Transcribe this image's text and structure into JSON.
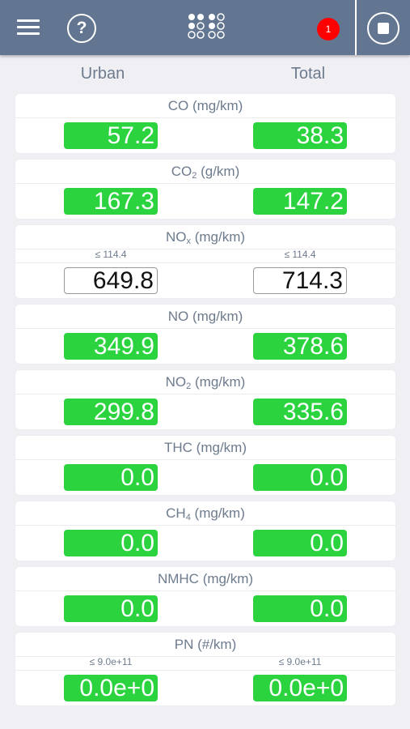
{
  "header": {
    "badge_count": "1",
    "icons": [
      "hamburger-menu-icon",
      "help-icon",
      "grid-dots-icon",
      "notification-badge",
      "stop-icon"
    ],
    "colors": {
      "bar": "#637691",
      "badge": "#ff0000"
    }
  },
  "columns": {
    "left": "Urban",
    "right": "Total"
  },
  "colors": {
    "ok": "#2bd33f",
    "exceeded": "#ffffff"
  },
  "rows": [
    {
      "name": "CO",
      "sub": "",
      "unit": " (mg/km)",
      "limit_urban": "",
      "limit_total": "",
      "urban": "57.2",
      "total": "38.3",
      "status": "ok"
    },
    {
      "name": "CO",
      "sub": "2",
      "unit": " (g/km)",
      "limit_urban": "",
      "limit_total": "",
      "urban": "167.3",
      "total": "147.2",
      "status": "ok"
    },
    {
      "name": "NO",
      "sub": "x",
      "unit": " (mg/km)",
      "limit_urban": "≤ 114.4",
      "limit_total": "≤ 114.4",
      "urban": "649.8",
      "total": "714.3",
      "status": "exceeded"
    },
    {
      "name": "NO",
      "sub": "",
      "unit": " (mg/km)",
      "limit_urban": "",
      "limit_total": "",
      "urban": "349.9",
      "total": "378.6",
      "status": "ok"
    },
    {
      "name": "NO",
      "sub": "2",
      "unit": " (mg/km)",
      "limit_urban": "",
      "limit_total": "",
      "urban": "299.8",
      "total": "335.6",
      "status": "ok"
    },
    {
      "name": "THC",
      "sub": "",
      "unit": " (mg/km)",
      "limit_urban": "",
      "limit_total": "",
      "urban": "0.0",
      "total": "0.0",
      "status": "ok"
    },
    {
      "name": "CH",
      "sub": "4",
      "unit": " (mg/km)",
      "limit_urban": "",
      "limit_total": "",
      "urban": "0.0",
      "total": "0.0",
      "status": "ok"
    },
    {
      "name": "NMHC",
      "sub": "",
      "unit": " (mg/km)",
      "limit_urban": "",
      "limit_total": "",
      "urban": "0.0",
      "total": "0.0",
      "status": "ok"
    },
    {
      "name": "PN",
      "sub": "",
      "unit": " (#/km)",
      "limit_urban": "≤ 9.0e+11",
      "limit_total": "≤ 9.0e+11",
      "urban": "0.0e+0",
      "total": "0.0e+0",
      "status": "ok"
    }
  ]
}
